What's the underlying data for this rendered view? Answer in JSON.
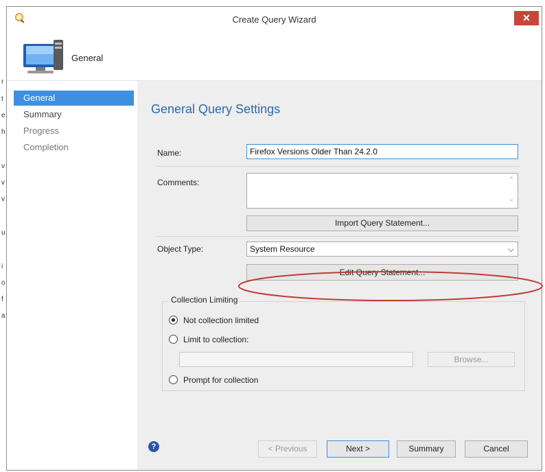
{
  "window": {
    "title": "Create Query Wizard",
    "close_label": "✕",
    "app_icon": "query-wizard-icon",
    "close_color": "#c7463a"
  },
  "background_text": [
    "r",
    "t",
    "e",
    "h",
    "v",
    "v",
    "v",
    "u",
    "i",
    "o",
    "f",
    "a"
  ],
  "header": {
    "icon": "computer-monitor-icon",
    "title": "General"
  },
  "nav": {
    "items": [
      {
        "label": "General",
        "state": "active"
      },
      {
        "label": "Summary",
        "state": "normal"
      },
      {
        "label": "Progress",
        "state": "disabled"
      },
      {
        "label": "Completion",
        "state": "disabled"
      }
    ],
    "active_color": "#3f8fe0"
  },
  "main": {
    "title": "General Query Settings",
    "title_color": "#2a6aad",
    "name": {
      "label": "Name:",
      "value": "Firefox Versions Older Than 24.2.0"
    },
    "comments": {
      "label": "Comments:",
      "value": ""
    },
    "import_button": "Import Query Statement...",
    "object_type": {
      "label": "Object Type:",
      "value": "System Resource"
    },
    "edit_button": "Edit Query Statement...",
    "highlight_color": "#c23a30",
    "collection": {
      "legend": "Collection Limiting",
      "options": [
        {
          "label": "Not collection limited",
          "selected": true
        },
        {
          "label": "Limit to collection:",
          "selected": false
        },
        {
          "label": "Prompt for collection",
          "selected": false
        }
      ],
      "collection_value": "",
      "browse_button": "Browse..."
    }
  },
  "footer": {
    "help_icon": "help-icon",
    "help_glyph": "?",
    "previous": "< Previous",
    "next": "Next >",
    "summary": "Summary",
    "cancel": "Cancel"
  }
}
